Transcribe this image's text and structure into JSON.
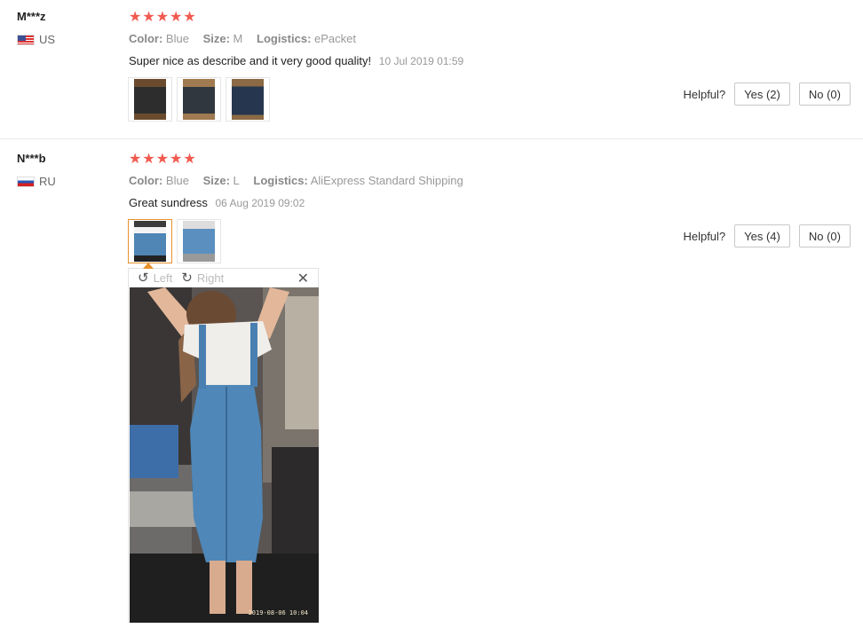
{
  "reviews": [
    {
      "user": "M***z",
      "country": "US",
      "stars": "★★★★★",
      "color_key": "Color:",
      "color_val": "Blue",
      "size_key": "Size:",
      "size_val": "M",
      "logistics_key": "Logistics:",
      "logistics_val": "ePacket",
      "text": "Super nice as describe and it very good quality!",
      "date": "10 Jul 2019 01:59",
      "helpful_label": "Helpful?",
      "yes_label": "Yes (2)",
      "no_label": "No (0)"
    },
    {
      "user": "N***b",
      "country": "RU",
      "stars": "★★★★★",
      "color_key": "Color:",
      "color_val": "Blue",
      "size_key": "Size:",
      "size_val": "L",
      "logistics_key": "Logistics:",
      "logistics_val": "AliExpress Standard Shipping",
      "text": "Great sundress",
      "date": "06 Aug 2019 09:02",
      "helpful_label": "Helpful?",
      "yes_label": "Yes (4)",
      "no_label": "No (0)"
    }
  ],
  "viewer": {
    "left_label": "Left",
    "right_label": "Right",
    "rotate_left_icon": "rotate-left-icon",
    "rotate_right_icon": "rotate-right-icon",
    "close_icon": "close-icon",
    "photo_timestamp": "2019-08-06 10:04"
  },
  "colors": {
    "stars": "#f15a4f",
    "active_thumb_border": "#e8912c"
  }
}
